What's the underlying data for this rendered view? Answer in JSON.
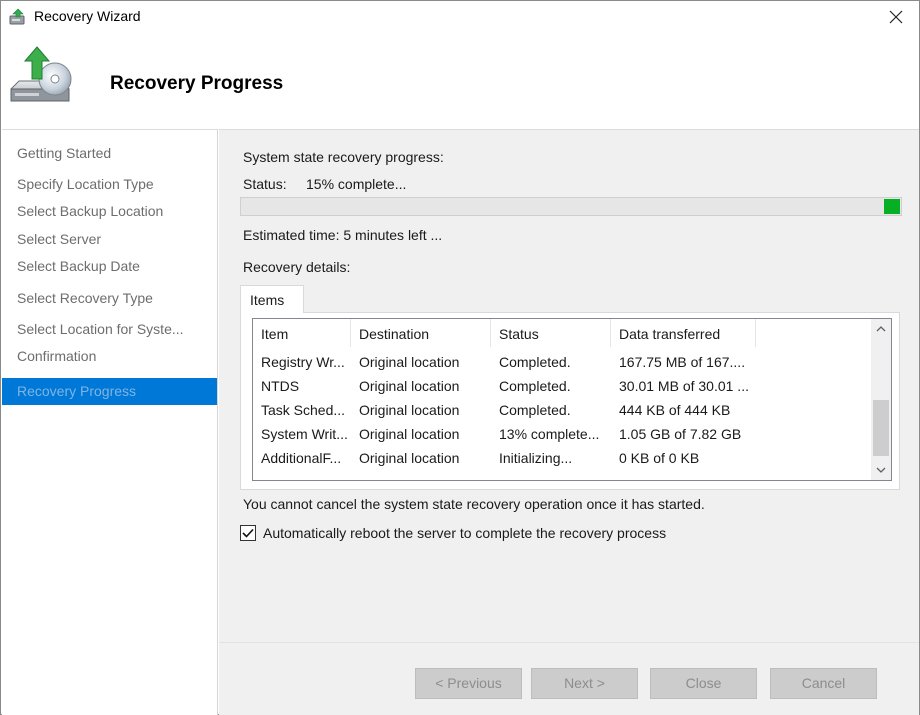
{
  "window": {
    "title": "Recovery Wizard"
  },
  "header": {
    "title": "Recovery Progress"
  },
  "sidebar": {
    "items": [
      {
        "label": "Getting Started"
      },
      {
        "label": "Specify Location Type"
      },
      {
        "label": "Select Backup Location"
      },
      {
        "label": "Select Server"
      },
      {
        "label": "Select Backup Date"
      },
      {
        "label": "Select Recovery Type"
      },
      {
        "label": "Select Location for Syste..."
      },
      {
        "label": "Confirmation"
      },
      {
        "label": "Recovery Progress",
        "active": true
      }
    ]
  },
  "main": {
    "progress_heading": "System state recovery progress:",
    "status_label": "Status:",
    "status_value": "15% complete...",
    "progress_fraction": 0.15,
    "estimated_time": "Estimated time: 5 minutes left ...",
    "details_label": "Recovery details:",
    "tab_label": "Items",
    "table": {
      "columns": [
        "Item",
        "Destination",
        "Status",
        "Data transferred",
        ""
      ],
      "rows": [
        [
          "Registry Wr...",
          "Original location",
          "Completed.",
          "167.75 MB of 167...."
        ],
        [
          "NTDS",
          "Original location",
          "Completed.",
          "30.01 MB of 30.01 ..."
        ],
        [
          "Task Sched...",
          "Original location",
          "Completed.",
          "444 KB of 444 KB"
        ],
        [
          "System Writ...",
          "Original location",
          "13% complete...",
          "1.05 GB of 7.82 GB"
        ],
        [
          "AdditionalF...",
          "Original location",
          "Initializing...",
          "0 KB of 0 KB"
        ]
      ]
    },
    "cancel_note": "You cannot cancel the system state recovery operation once it has started.",
    "reboot_checkbox": {
      "label": "Automatically reboot the server to complete the recovery process",
      "checked": true
    }
  },
  "footer": {
    "previous": "< Previous",
    "next": "Next >",
    "close": "Close",
    "cancel": "Cancel"
  },
  "colors": {
    "accent": "#0078d7",
    "progress_fill": "#06b025"
  }
}
